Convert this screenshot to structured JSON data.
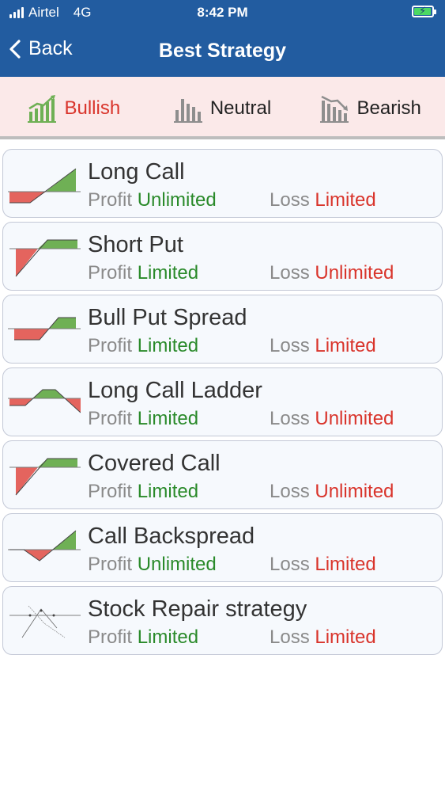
{
  "status": {
    "carrier": "Airtel",
    "network": "4G",
    "time": "8:42 PM"
  },
  "nav": {
    "back_label": "Back",
    "title": "Best Strategy"
  },
  "tabs": [
    {
      "label": "Bullish",
      "icon": "bar-chart-up-icon",
      "active": true
    },
    {
      "label": "Neutral",
      "icon": "bar-chart-neutral-icon",
      "active": false
    },
    {
      "label": "Bearish",
      "icon": "bar-chart-down-icon",
      "active": false
    }
  ],
  "labels": {
    "profit": "Profit",
    "loss": "Loss"
  },
  "colors": {
    "header": "#225ca0",
    "tab_background": "#fbe9e9",
    "active_tab": "#d9342b",
    "profit": "#2a8a2a",
    "loss": "#d9342b",
    "graph_profit": "#6fb055",
    "graph_loss": "#e4645e"
  },
  "strategies": [
    {
      "name": "Long Call",
      "profit": "Unlimited",
      "loss": "Limited",
      "graph": "long-call-payoff-icon"
    },
    {
      "name": "Short Put",
      "profit": "Limited",
      "loss": "Unlimited",
      "graph": "short-put-payoff-icon"
    },
    {
      "name": "Bull Put Spread",
      "profit": "Limited",
      "loss": "Limited",
      "graph": "bull-put-spread-payoff-icon"
    },
    {
      "name": "Long Call Ladder",
      "profit": "Limited",
      "loss": "Unlimited",
      "graph": "long-call-ladder-payoff-icon"
    },
    {
      "name": " Covered Call",
      "profit": "Limited",
      "loss": "Unlimited",
      "graph": "covered-call-payoff-icon"
    },
    {
      "name": "Call Backspread",
      "profit": "Unlimited",
      "loss": "Limited",
      "graph": "call-backspread-payoff-icon"
    },
    {
      "name": "Stock Repair strategy",
      "profit": "Limited",
      "loss": "Limited",
      "graph": "stock-repair-payoff-icon"
    }
  ]
}
